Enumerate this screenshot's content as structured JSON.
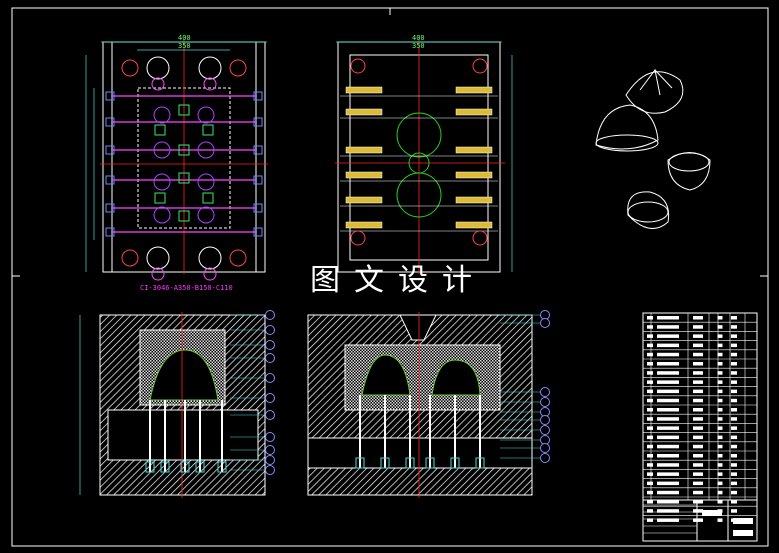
{
  "drawing": {
    "watermark": "图文设计",
    "plan_view_label": "CI-3046-A350-B150-C110",
    "plan_view": {
      "width_overall": "400",
      "width_inner": "350"
    },
    "side_view": {
      "width_overall": "400",
      "width_inner": "350"
    }
  },
  "colors": {
    "background": "#000000",
    "frame": "#ffffff",
    "hatch": "#ffffff",
    "dim": "#66ff66",
    "center": "#ff2020",
    "balloon": "#8080ff",
    "cyan": "#40e0d0",
    "magenta": "#ff40ff"
  }
}
